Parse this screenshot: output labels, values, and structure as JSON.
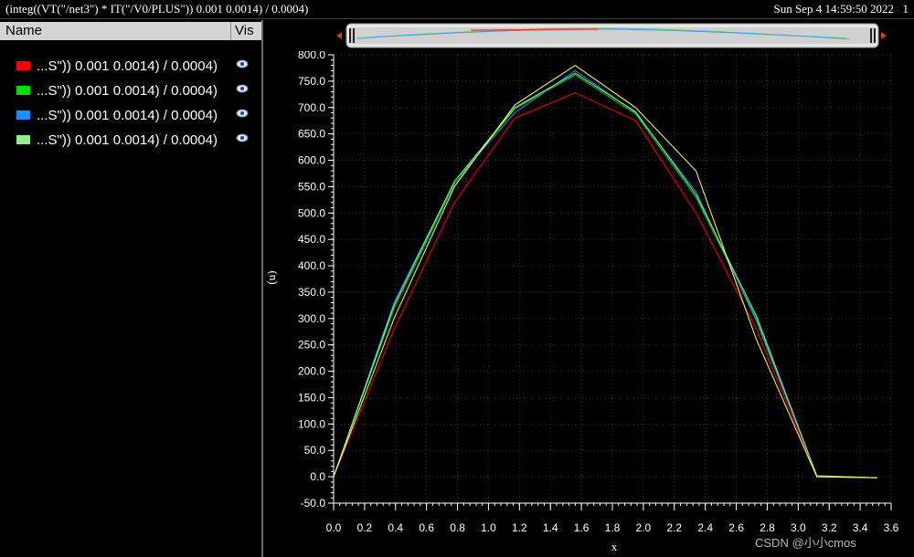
{
  "window": {
    "title": "(integ((VT(\"/net3\") * IT(\"/V0/PLUS\")) 0.001 0.0014) / 0.0004)",
    "datetime": "Sun Sep 4 14:59:50 2022",
    "page": "1"
  },
  "legend": {
    "header_name": "Name",
    "header_vis": "Vis",
    "items": [
      {
        "label": "...S\")) 0.001 0.0014) / 0.0004)",
        "color": "#ff0000",
        "icon": "eye-icon"
      },
      {
        "label": "...S\")) 0.001 0.0014) / 0.0004)",
        "color": "#00e000",
        "icon": "eye-icon"
      },
      {
        "label": "...S\")) 0.001 0.0014) / 0.0004)",
        "color": "#1e8fff",
        "icon": "eye-icon"
      },
      {
        "label": "...S\")) 0.001 0.0014) / 0.0004)",
        "color": "#90ee90",
        "icon": "eye-icon"
      }
    ]
  },
  "watermark": "CSDN @小小cmos",
  "chart_data": {
    "type": "line",
    "xlabel": "x",
    "ylabel": "(u)",
    "xlim": [
      0.0,
      3.6
    ],
    "ylim": [
      -50.0,
      800.0
    ],
    "xticks": [
      0.0,
      0.2,
      0.4,
      0.6,
      0.8,
      1.0,
      1.2,
      1.4,
      1.6,
      1.8,
      2.0,
      2.2,
      2.4,
      2.6,
      2.8,
      3.0,
      3.2,
      3.4,
      3.6
    ],
    "xtick_labels": [
      "0.0",
      "0.2",
      "0.4",
      "0.6",
      "0.8",
      "1.0",
      "1.2",
      "1.4",
      "1.6",
      "1.8",
      "2.0",
      "2.2",
      "2.4",
      "2.6",
      "2.8",
      "3.0",
      "3.2",
      "3.4",
      "3.6"
    ],
    "yticks": [
      -50,
      0,
      50,
      100,
      150,
      200,
      250,
      300,
      350,
      400,
      450,
      500,
      550,
      600,
      650,
      700,
      750,
      800
    ],
    "ytick_labels": [
      "-50.0",
      "0.0",
      "50.0",
      "100.0",
      "150.0",
      "200.0",
      "250.0",
      "300.0",
      "350.0",
      "400.0",
      "450.0",
      "500.0",
      "550.0",
      "600.0",
      "650.0",
      "700.0",
      "750.0",
      "800.0"
    ],
    "grid": true,
    "colors": [
      "#ff0000",
      "#00e000",
      "#1e8fff",
      "#90ee90",
      "#ffff66"
    ],
    "series": [
      {
        "x": [
          0.0,
          0.39,
          0.78,
          1.17,
          1.56,
          1.95,
          2.34,
          2.73,
          3.12,
          3.51
        ],
        "values": [
          0,
          280,
          520,
          680,
          728,
          675,
          500,
          280,
          0,
          -2
        ]
      },
      {
        "x": [
          0.0,
          0.39,
          0.78,
          1.17,
          1.56,
          1.95,
          2.34,
          2.73,
          3.12,
          3.51
        ],
        "values": [
          0,
          320,
          555,
          698,
          762,
          688,
          530,
          300,
          2,
          -2
        ]
      },
      {
        "x": [
          0.0,
          0.39,
          0.78,
          1.17,
          1.56,
          1.95,
          2.34,
          2.73,
          3.12,
          3.51
        ],
        "values": [
          0,
          330,
          560,
          690,
          770,
          690,
          540,
          295,
          2,
          -2
        ]
      },
      {
        "x": [
          0.0,
          0.39,
          0.78,
          1.17,
          1.56,
          1.95,
          2.34,
          2.73,
          3.12,
          3.51
        ],
        "values": [
          0,
          325,
          560,
          700,
          765,
          692,
          535,
          305,
          2,
          -2
        ]
      },
      {
        "x": [
          0.0,
          0.39,
          0.78,
          1.17,
          1.56,
          1.95,
          2.34,
          2.73,
          3.12,
          3.51
        ],
        "values": [
          0,
          300,
          550,
          705,
          780,
          700,
          580,
          260,
          0,
          -2
        ]
      }
    ]
  }
}
